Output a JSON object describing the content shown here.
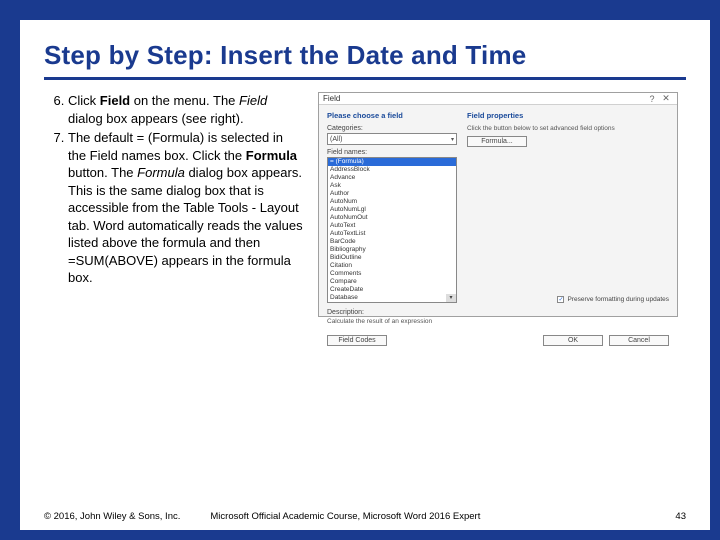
{
  "title": "Step by Step: Insert the Date and Time",
  "steps": {
    "s6": {
      "pre": "Click ",
      "bold1": "Field",
      "mid1": " on the menu. The ",
      "ital1": "Field",
      "post1": " dialog box appears (see right)."
    },
    "s7": {
      "pre": "The default = (Formula) is selected in the Field names box. Click the ",
      "bold1": "Formula",
      "mid1": " button. The ",
      "ital1": "Formula",
      "post1": " dialog box appears. This is the same dialog box that is accessible from the Table Tools - Layout tab. Word automatically reads the values listed above the formula and then =SUM(ABOVE) appears in the formula box."
    }
  },
  "dialog": {
    "title": "Field",
    "help": "?",
    "close": "✕",
    "left_heading": "Please choose a field",
    "categories_label": "Categories:",
    "categories_value": "(All)",
    "fieldnames_label": "Field names:",
    "list": [
      "= (Formula)",
      "AddressBlock",
      "Advance",
      "Ask",
      "Author",
      "AutoNum",
      "AutoNumLgl",
      "AutoNumOut",
      "AutoText",
      "AutoTextList",
      "BarCode",
      "Bibliography",
      "BidiOutline",
      "Citation",
      "Comments",
      "Compare",
      "CreateDate",
      "Database"
    ],
    "right_heading": "Field properties",
    "right_hint": "Click the button below to set advanced field options",
    "formula_btn": "Formula...",
    "preserve": "Preserve formatting during updates",
    "desc_label": "Description:",
    "desc_text": "Calculate the result of an expression",
    "fieldcodes_btn": "Field Codes",
    "ok_btn": "OK",
    "cancel_btn": "Cancel"
  },
  "footer": {
    "copyright": "© 2016, John Wiley & Sons, Inc.",
    "course": "Microsoft Official Academic Course, Microsoft Word 2016 Expert",
    "page": "43"
  }
}
